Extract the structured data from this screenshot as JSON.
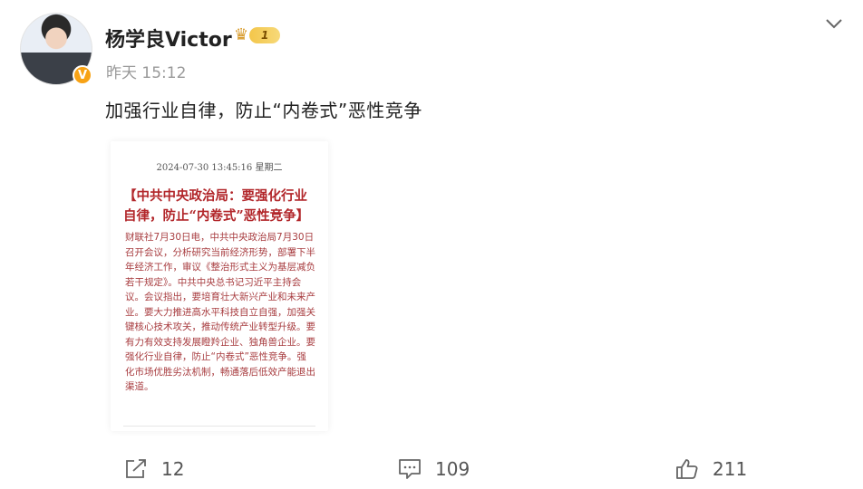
{
  "post": {
    "author": "杨学良Victor",
    "level": "1",
    "time": "昨天 15:12",
    "text": "加强行业自律，防止“内卷式”恶性竞争",
    "image": {
      "date": "2024-07-30 13:45:16 星期二",
      "headline": "【中共中央政治局：要强化行业自律，防止“内卷式”恶性竞争】",
      "body": "财联社7月30日电，中共中央政治局7月30日召开会议，分析研究当前经济形势，部署下半年经济工作，审议《整治形式主义为基层减负若干规定》。中共中央总书记习近平主持会议。会议指出，要培育壮大新兴产业和未来产业。要大力推进高水平科技自立自强，加强关键核心技术攻关，推动传统产业转型升级。要有力有效支持发展瞪羚企业、独角兽企业。要强化行业自律，防止“内卷式”恶性竞争。强化市场优胜劣汰机制，畅通落后低效产能退出渠道。"
    }
  },
  "actions": {
    "share_count": "12",
    "comment_count": "109",
    "like_count": "211"
  },
  "icons": {
    "verified": "v-badge-icon",
    "crown": "crown-icon",
    "more": "chevron-down-icon",
    "share": "share-icon",
    "comment": "comment-icon",
    "like": "thumbs-up-icon"
  },
  "colors": {
    "badge_orange": "#f7a215",
    "headline_red": "#b2262a",
    "body_red": "#a83d40",
    "timestamp_gray": "#999999"
  }
}
